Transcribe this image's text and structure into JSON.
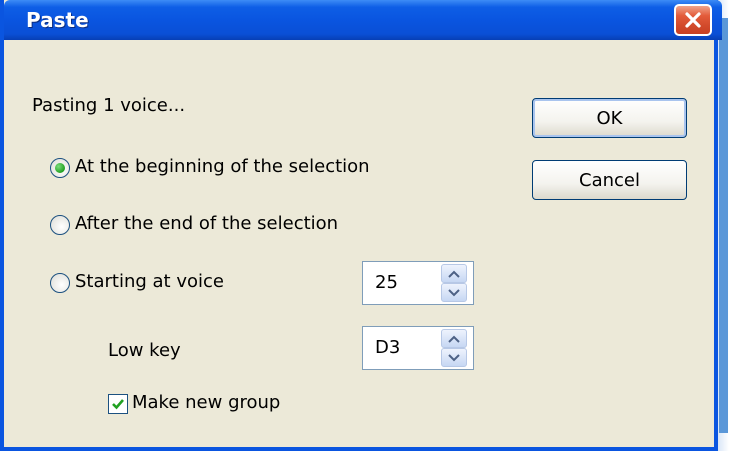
{
  "window": {
    "title": "Paste"
  },
  "dialog": {
    "status_text": "Pasting 1 voice...",
    "options": [
      {
        "label": "At the beginning of the selection",
        "selected": true
      },
      {
        "label": "After the end of the selection",
        "selected": false
      },
      {
        "label": "Starting at voice",
        "selected": false
      }
    ],
    "start_voice": {
      "value": "25"
    },
    "low_key": {
      "label": "Low key",
      "value": "D3"
    },
    "make_new_group": {
      "label": "Make new group",
      "checked": true
    },
    "buttons": {
      "ok": "OK",
      "cancel": "Cancel"
    }
  },
  "colors": {
    "titlebar": "#0a55e0",
    "dialog_bg": "#ece9d8",
    "close_button": "#d24a2b",
    "check_mark": "#21a121"
  },
  "icons": [
    "close-icon",
    "arrow-up-icon",
    "arrow-down-icon",
    "check-icon"
  ]
}
